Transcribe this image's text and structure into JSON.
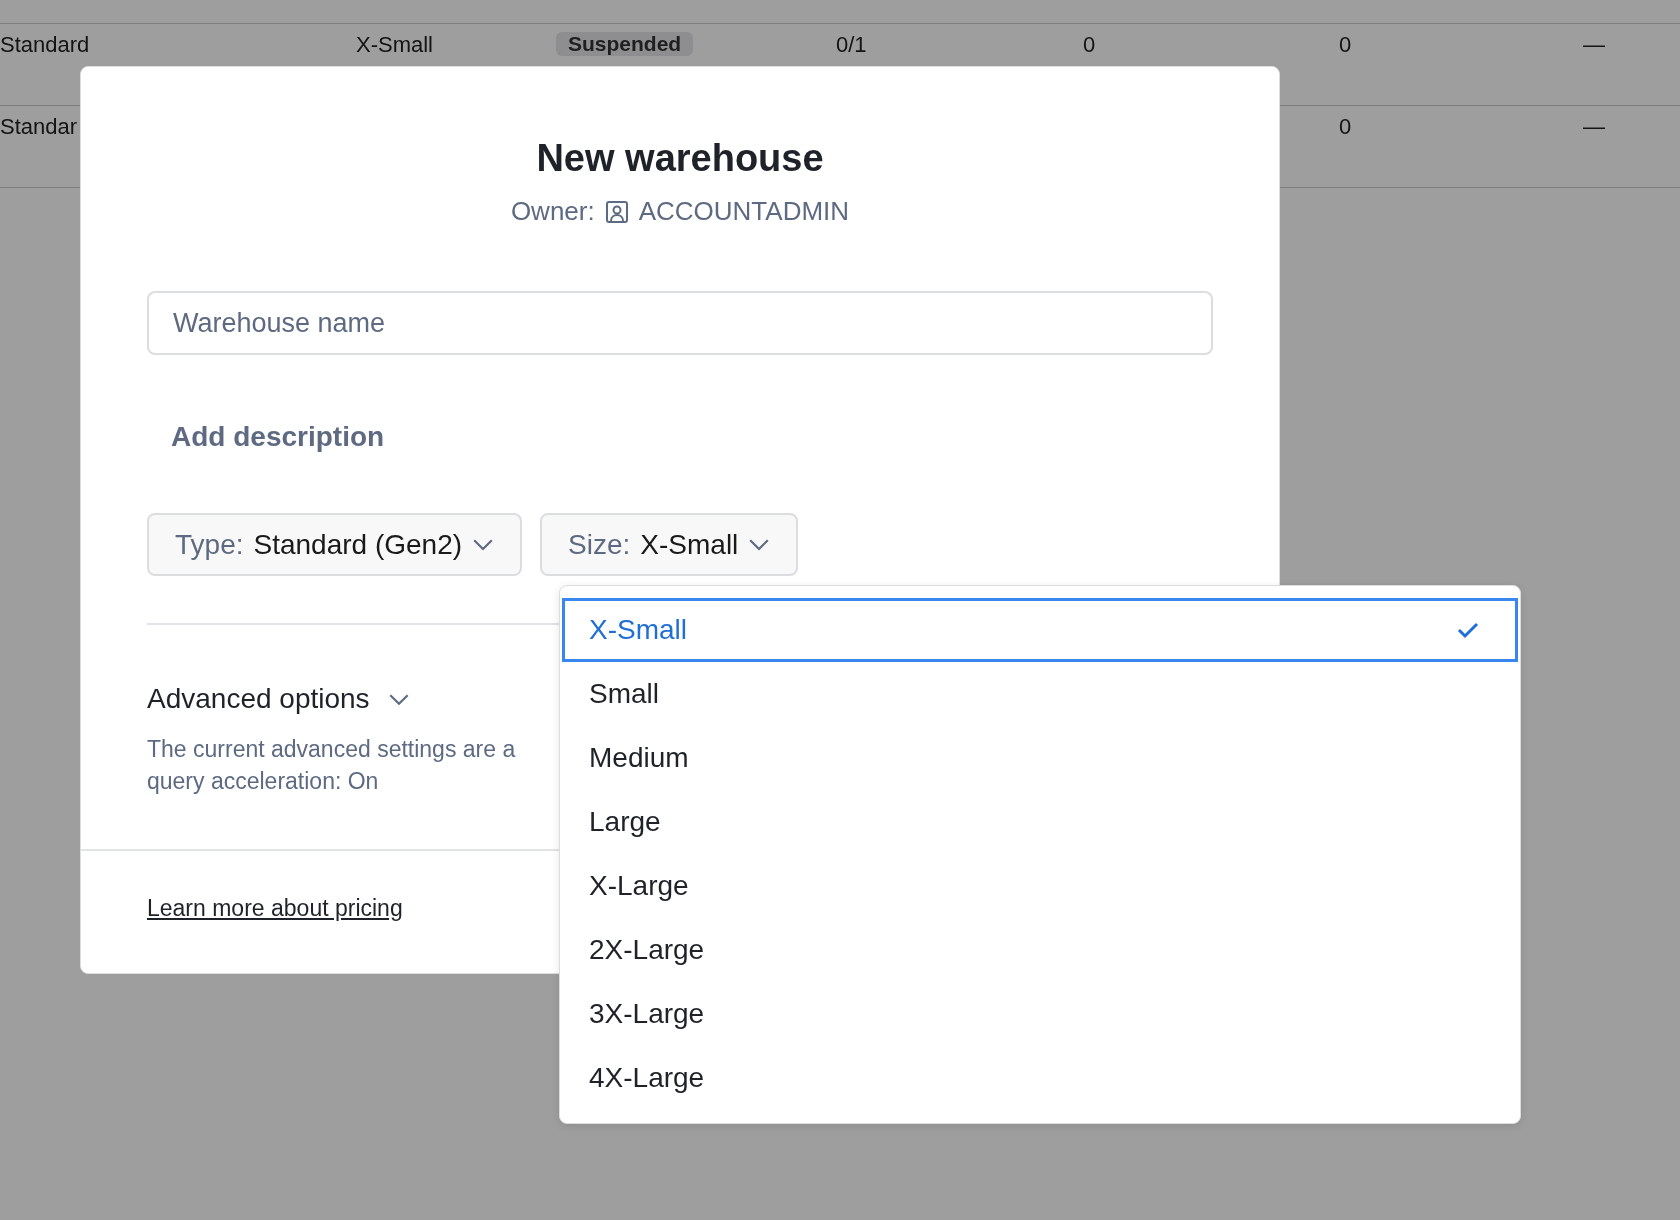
{
  "table": {
    "rows": [
      {
        "column_1": "Standard",
        "column_2": "X-Small",
        "column_3": "Suspended",
        "column_4": "0/1",
        "column_5": "0",
        "column_6": "0",
        "column_7": "—"
      },
      {
        "column_1": "Standar",
        "column_6": "0",
        "column_7": "—"
      }
    ]
  },
  "dialog": {
    "title": "New warehouse",
    "owner_label": "Owner:",
    "owner": "ACCOUNTADMIN",
    "name_field": {
      "placeholder": "Warehouse name"
    },
    "add_description": "Add description",
    "type_select": {
      "label": "Type:",
      "value": "Standard (Gen2)"
    },
    "size_select": {
      "label": "Size:",
      "value": "X-Small"
    },
    "advanced": {
      "title": "Advanced options",
      "expanded": false,
      "lines": [
        "The current advanced settings are a",
        "query acceleration: On"
      ]
    },
    "footer_link": "Learn more about pricing"
  },
  "size_menu": {
    "options": [
      {
        "label": "X-Small",
        "selected": true
      },
      {
        "label": "Small",
        "selected": false
      },
      {
        "label": "Medium",
        "selected": false
      },
      {
        "label": "Large",
        "selected": false
      },
      {
        "label": "X-Large",
        "selected": false
      },
      {
        "label": "2X-Large",
        "selected": false
      },
      {
        "label": "3X-Large",
        "selected": false
      },
      {
        "label": "4X-Large",
        "selected": false
      }
    ]
  }
}
